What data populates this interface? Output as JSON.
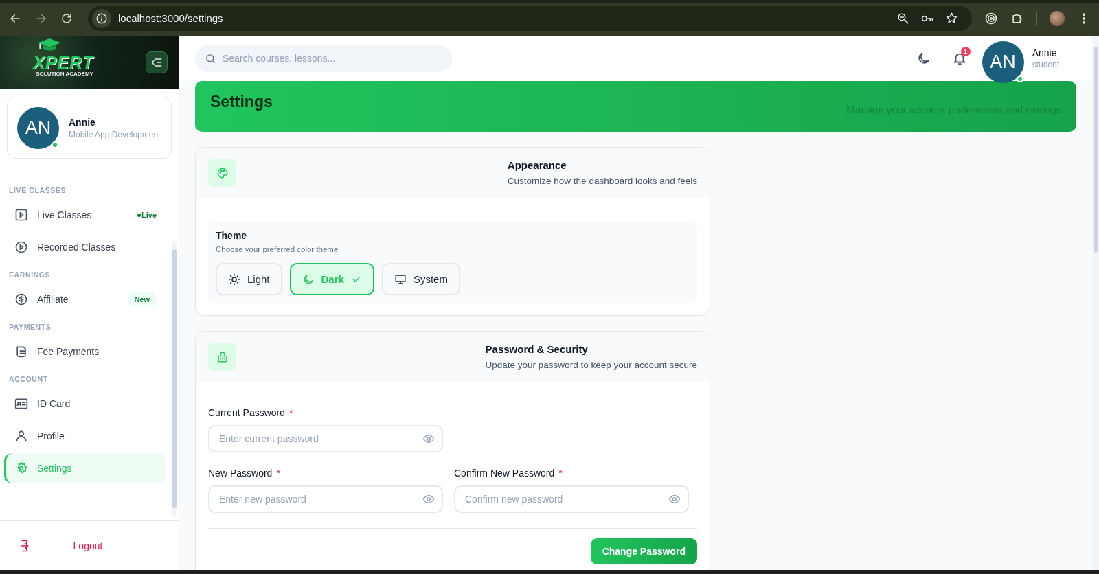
{
  "browser": {
    "url": "localhost:3000/settings"
  },
  "sidebar": {
    "logo": {
      "name": "XPERT",
      "tagline": "SOLUTION ACADEMY"
    },
    "profile": {
      "initials": "AN",
      "name": "Annie",
      "course": "Mobile App Development",
      "online": true
    },
    "sections": [
      {
        "title": "LIVE CLASSES",
        "items": [
          {
            "label": "Live Classes",
            "kind": "live",
            "selected": false,
            "badge": {
              "kind": "live",
              "text": "Live"
            }
          },
          {
            "label": "Recorded Classes",
            "kind": "recorded",
            "selected": false
          }
        ]
      },
      {
        "title": "EARNINGS",
        "items": [
          {
            "label": "Affiliate",
            "kind": "affiliate",
            "selected": false,
            "badge": {
              "kind": "new",
              "text": "New"
            }
          }
        ]
      },
      {
        "title": "PAYMENTS",
        "items": [
          {
            "label": "Fee Payments",
            "kind": "payments",
            "selected": false
          }
        ]
      },
      {
        "title": "ACCOUNT",
        "items": [
          {
            "label": "ID Card",
            "kind": "idcard",
            "selected": false
          },
          {
            "label": "Profile",
            "kind": "profile",
            "selected": false
          },
          {
            "label": "Settings",
            "kind": "settings",
            "selected": true
          }
        ]
      }
    ],
    "logout": "Logout"
  },
  "header": {
    "search_placeholder": "Search courses, lessons...",
    "notifications": "1",
    "user": {
      "initials": "AN",
      "name": "Annie",
      "role": "student",
      "online": true
    }
  },
  "banner": {
    "title": "Settings",
    "subtitle": "Manage your account preferences and settings"
  },
  "appearance": {
    "title": "Appearance",
    "subtitle": "Customize how the dashboard looks and feels",
    "theme_label": "Theme",
    "theme_hint": "Choose your preferred color theme",
    "options": [
      {
        "label": "Light",
        "kind": "light",
        "selected": false
      },
      {
        "label": "Dark",
        "kind": "dark",
        "selected": true
      },
      {
        "label": "System",
        "kind": "system",
        "selected": false
      }
    ]
  },
  "security": {
    "title": "Password & Security",
    "subtitle": "Update your password to keep your account secure",
    "rows": [
      [
        {
          "label": "Current Password",
          "required_mark": "*",
          "placeholder": "Enter current password"
        }
      ],
      [
        {
          "label": "New Password",
          "required_mark": "*",
          "placeholder": "Enter new password"
        },
        {
          "label": "Confirm New Password",
          "required_mark": "*",
          "placeholder": "Confirm new password"
        }
      ]
    ],
    "button": "Change Password"
  }
}
